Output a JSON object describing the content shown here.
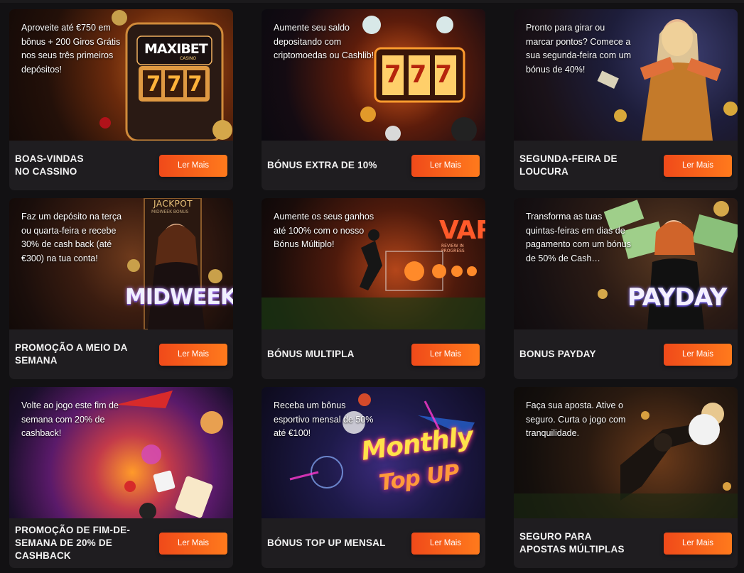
{
  "colors": {
    "accent_start": "#f04a1a",
    "accent_end": "#ff7a1c",
    "card_bg": "#1f1d20",
    "page_bg": "#121113"
  },
  "cards": [
    {
      "description": "Aproveite até €750 em bônus + 200 Giros Grátis nos seus três primeiros depósitos!",
      "title_line1": "BOAS-VINDAS",
      "title_line2": "NO CASSINO",
      "button_label": "Ler Mais",
      "art_logo": "MAXIBET",
      "art_logo_sub": "CASINO",
      "art_reels": "777"
    },
    {
      "description": "Aumente seu saldo depositando com criptomoedas ou Cashlib!",
      "title_line1": "BÓNUS EXTRA DE 10%",
      "title_line2": "",
      "button_label": "Ler Mais",
      "art_reels": "777"
    },
    {
      "description": "Pronto para girar ou marcar pontos? Comece a sua segunda-feira com um bónus de 40%!",
      "title_line1": "SEGUNDA-FEIRA DE",
      "title_line2": "LOUCURA",
      "button_label": "Ler Mais"
    },
    {
      "description": "Faz um depósito na terça ou quarta-feira e recebe 30% de cash back (até €300) na tua conta!",
      "title_line1": "PROMOÇÃO A MEIO DA",
      "title_line2": "SEMANA",
      "button_label": "Ler Mais",
      "art_word": "MIDWEEK",
      "art_small": "JACKPOT",
      "art_small2": "MIDWEEK BONUS"
    },
    {
      "description": "Aumente os seus ganhos até 100% com o nosso Bónus Múltiplo!",
      "title_line1": "BÓNUS MULTIPLA",
      "title_line2": "",
      "button_label": "Ler Mais",
      "art_word": "VAR",
      "art_small": "REVIEW IN PROGRESS"
    },
    {
      "description": "Transforma as tuas quintas-feiras em dias de pagamento com um bónus de 50% de Cash…",
      "title_line1": "BONUS PAYDAY",
      "title_line2": "",
      "button_label": "Ler Mais",
      "art_word": "PAYDAY"
    },
    {
      "description": "Volte ao jogo este fim de semana com 20% de cashback!",
      "title_line1": "PROMOÇÃO DE FIM-DE-",
      "title_line2": "SEMANA DE 20% DE",
      "title_line3": "CASHBACK",
      "button_label": "Ler Mais"
    },
    {
      "description": "Receba um bônus esportivo mensal de 50% até €100!",
      "title_line1": "BÓNUS TOP UP MENSAL",
      "title_line2": "",
      "button_label": "Ler Mais",
      "art_word": "Monthly",
      "art_word2": "Top UP"
    },
    {
      "description": "Faça sua aposta. Ative o seguro. Curta o jogo com tranquilidade.",
      "title_line1": "SEGURO PARA",
      "title_line2": "APOSTAS MÚLTIPLAS",
      "button_label": "Ler Mais"
    }
  ]
}
